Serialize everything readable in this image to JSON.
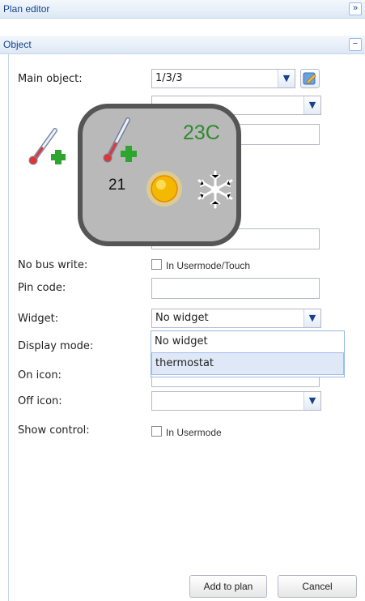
{
  "plan_editor": {
    "title": "Plan editor",
    "toggle_icon": "double-chevron-right-icon",
    "toggle_label": "»"
  },
  "object_panel": {
    "title": "Object",
    "collapse_icon": "minus-icon",
    "collapse_label": "−"
  },
  "form": {
    "main_object_label": "Main object:",
    "main_object_value": "1/3/3",
    "no_bus_write_label": "No bus write:",
    "no_bus_write_checkbox": "In Usermode/Touch",
    "pin_code_label": "Pin code:",
    "pin_code_value": "",
    "widget_label": "Widget:",
    "widget_value": "No widget",
    "display_mode_label": "Display mode:",
    "on_icon_label": "On icon:",
    "off_icon_label": "Off icon:",
    "off_icon_value": "",
    "show_control_label": "Show control:",
    "show_control_checkbox": "In Usermode"
  },
  "widget_dropdown": {
    "options": [
      "No widget",
      "thermostat"
    ],
    "highlighted": "thermostat"
  },
  "thermostat_preview": {
    "setpoint": "23C",
    "current": "21"
  },
  "buttons": {
    "add_to_plan": "Add to plan",
    "cancel": "Cancel"
  },
  "colors": {
    "header_text": "#15428b",
    "preview_bg": "#b9b9b9",
    "setpoint_color": "#2e8b2e"
  }
}
